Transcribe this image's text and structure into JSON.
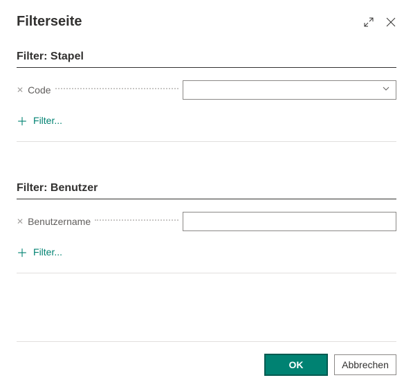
{
  "header": {
    "title": "Filterseite"
  },
  "sections": {
    "stapel": {
      "title": "Filter: Stapel",
      "field_label": "Code",
      "field_value": "",
      "add_filter_label": "Filter..."
    },
    "benutzer": {
      "title": "Filter: Benutzer",
      "field_label": "Benutzername",
      "field_value": "",
      "add_filter_label": "Filter..."
    }
  },
  "footer": {
    "ok_label": "OK",
    "cancel_label": "Abbrechen"
  }
}
